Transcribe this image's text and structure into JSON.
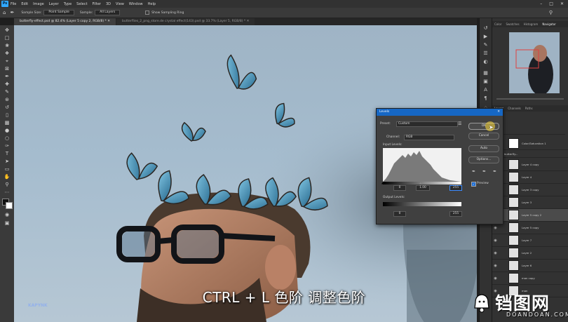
{
  "app": {
    "logo": "Ps",
    "menu": [
      "File",
      "Edit",
      "Image",
      "Layer",
      "Type",
      "Select",
      "Filter",
      "3D",
      "View",
      "Window",
      "Help"
    ]
  },
  "options": {
    "sample_size_label": "Sample Size:",
    "sample_size_value": "Point Sample",
    "sample_label": "Sample:",
    "sample_value": "All Layers",
    "show_ring_label": "Show Sampling Ring"
  },
  "tabs": [
    {
      "label": "butterfly-effect.psd @ 82.4% (Layer 5 copy 2, RGB/8) *",
      "active": true
    },
    {
      "label": "butterflies_2_png_store.de crystal effect(143).psd @ 33.7% (Layer 5, RGB/8) *",
      "active": false
    }
  ],
  "panels": {
    "top_tabs": [
      "Color",
      "Swatches",
      "Histogram",
      "Navigator"
    ],
    "top_active": "Navigator",
    "layer_tabs": [
      "Layers",
      "Channels",
      "Paths"
    ],
    "layer_active": "Layers",
    "group_row": "Color/Saturation 1",
    "folder_row": "butterfly...",
    "layers": [
      {
        "name": "Layer 4 copy",
        "selected": false
      },
      {
        "name": "Layer 4",
        "selected": false
      },
      {
        "name": "Layer 3 copy",
        "selected": false
      },
      {
        "name": "Layer 3",
        "selected": false
      },
      {
        "name": "Layer 5 copy 2",
        "selected": true
      },
      {
        "name": "Layer 5 copy",
        "selected": false
      },
      {
        "name": "Layer 7",
        "selected": false
      },
      {
        "name": "Layer 2",
        "selected": false
      },
      {
        "name": "Layer 6",
        "selected": false
      },
      {
        "name": "man copy",
        "selected": false
      },
      {
        "name": "man",
        "selected": false
      }
    ]
  },
  "levels": {
    "title": "Levels",
    "preset_label": "Preset:",
    "preset_value": "Custom",
    "channel_label": "Channel:",
    "channel_value": "RGB",
    "input_label": "Input Levels:",
    "input_black": "0",
    "input_gamma": "1.00",
    "input_white": "255",
    "output_label": "Output Levels:",
    "output_black": "0",
    "output_white": "255",
    "buttons": [
      "OK",
      "Cancel",
      "Auto",
      "Options..."
    ],
    "preview_label": "Preview",
    "preview_checked": true
  },
  "overlay": {
    "subtitle": "CTRL + L 色阶 调整色阶",
    "watermark": "KAPYNK",
    "brand_big": "铛图网",
    "brand_small": "DOANDOAN.COM"
  }
}
